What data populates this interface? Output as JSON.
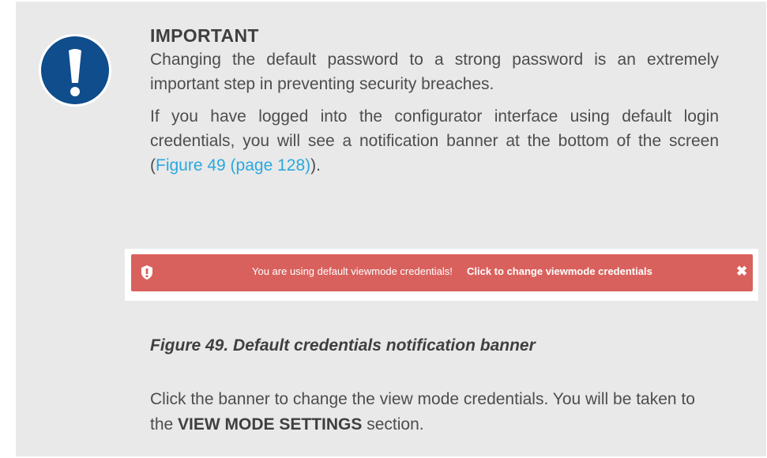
{
  "notice": {
    "heading": "IMPORTANT",
    "icon": "exclamation-circle-icon",
    "icon_color": "#0f4d8c",
    "paragraph1": "Changing the default password to a strong password is an extremely important step in preventing security breaches.",
    "paragraph2_text": "If you have logged into the configurator interface using default login credentials, you will see a notification banner at the bottom of the screen (",
    "paragraph2_link": "Figure 49 (page 128)",
    "paragraph2_end": ")."
  },
  "banner": {
    "icon": "shield-exclamation-icon",
    "message": "You are using default viewmode credentials!",
    "link_text": "Click to change viewmode credentials",
    "close_icon": "close-icon",
    "close_glyph": "✖",
    "background_color": "#d9615d"
  },
  "figure": {
    "caption": "Figure 49. Default credentials notification banner"
  },
  "footer": {
    "text_before": "Click the banner to change the view mode credentials. You will be taken to the ",
    "bold_text": "VIEW MODE SETTINGS",
    "text_after": " section."
  }
}
